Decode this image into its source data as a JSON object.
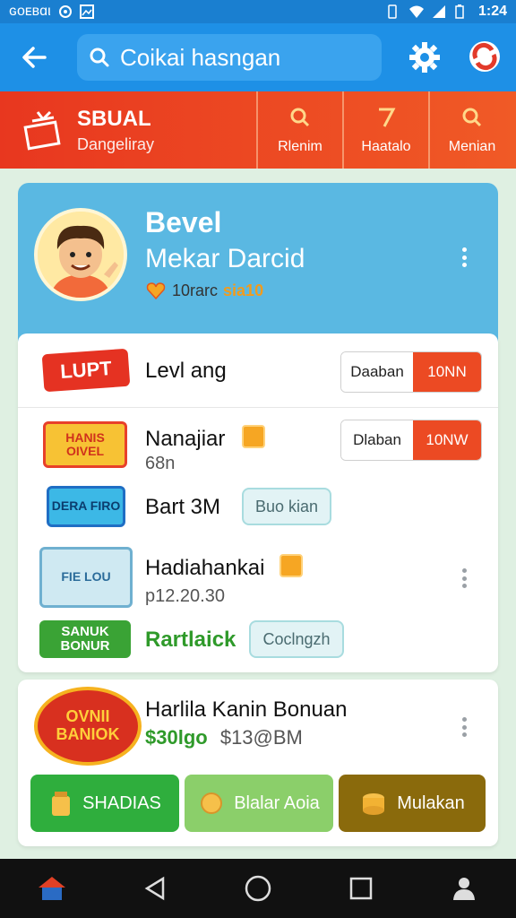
{
  "status_bar": {
    "carrier": "ɢᴏᴇʙɑι",
    "time": "1:24"
  },
  "app_bar": {
    "search_text": "Coikai hasngan"
  },
  "banner": {
    "title": "SBUAL",
    "subtitle": "Dangeliray",
    "tabs": [
      {
        "label": "Rlenim"
      },
      {
        "label": "Haatalo"
      },
      {
        "label": "Menian"
      }
    ]
  },
  "profile": {
    "level": "Bevel",
    "name": "Mekar Darcid",
    "points_label": "10rarc",
    "points_value": "sia10"
  },
  "list": {
    "items": [
      {
        "thumb": "LUPT",
        "title": "Levl ang",
        "btn_a": "Daaban",
        "btn_b": "10NN"
      },
      {
        "thumb": "HANIS OIVEL",
        "title": "Nanajiar",
        "sub": "68n",
        "btn_a": "Dlaban",
        "btn_b": "10NW"
      },
      {
        "thumb": "DERA FIRO",
        "title": "Bart 3M",
        "pill": "Buo kian"
      },
      {
        "thumb": "FIE LOU",
        "title": "Hadiahankai",
        "sub": "p12.20.30"
      },
      {
        "thumb": "SANUK BONUR",
        "title": "Rartlaick",
        "pill": "Coclngzh"
      }
    ]
  },
  "bonus": {
    "thumb": "OVNII BANIOK",
    "title": "Harlila Kanin Bonuan",
    "price_green": "$30lgo",
    "price_gray": "$13@BM",
    "actions": [
      {
        "label": "SHADIAS",
        "color": "#2fae3d"
      },
      {
        "label": "Blalar Aoia",
        "color": "#8bcf6a"
      },
      {
        "label": "Mulakan",
        "color": "#8a6a0c"
      }
    ]
  }
}
